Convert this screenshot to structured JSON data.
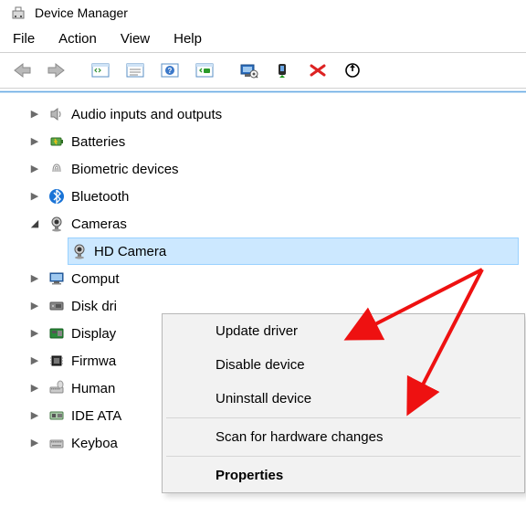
{
  "titlebar": {
    "title": "Device Manager"
  },
  "menubar": {
    "file": "File",
    "action": "Action",
    "view": "View",
    "help": "Help"
  },
  "tree": {
    "items": [
      {
        "label": "Audio inputs and outputs",
        "expanded": false
      },
      {
        "label": "Batteries",
        "expanded": false
      },
      {
        "label": "Biometric devices",
        "expanded": false
      },
      {
        "label": "Bluetooth",
        "expanded": false
      },
      {
        "label": "Cameras",
        "expanded": true,
        "children": [
          {
            "label": "HD Camera",
            "selected": true
          }
        ]
      },
      {
        "label": "Comput",
        "expanded": false
      },
      {
        "label": "Disk dri",
        "expanded": false
      },
      {
        "label": "Display",
        "expanded": false
      },
      {
        "label": "Firmwa",
        "expanded": false
      },
      {
        "label": "Human",
        "expanded": false
      },
      {
        "label": "IDE ATA",
        "expanded": false
      },
      {
        "label": "Keyboa",
        "expanded": false
      }
    ]
  },
  "context_menu": {
    "update": "Update driver",
    "disable": "Disable device",
    "uninstall": "Uninstall device",
    "scan": "Scan for hardware changes",
    "properties": "Properties"
  }
}
